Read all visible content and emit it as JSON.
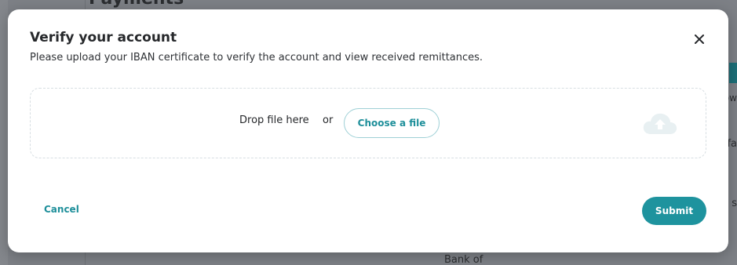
{
  "background": {
    "page_title": "Payments",
    "bank_text": "Bank of",
    "edge_text_1": "ow",
    "edge_text_2": "fa",
    "edge_text_3": "s"
  },
  "modal": {
    "title": "Verify your account",
    "subtitle": "Please upload your IBAN certificate to verify the account and view received remittances.",
    "close_icon": "close-icon",
    "dropzone": {
      "drop_label": "Drop file here",
      "or_label": "or",
      "choose_button": "Choose a file",
      "upload_icon": "cloud-upload-icon"
    },
    "cancel_label": "Cancel",
    "submit_label": "Submit"
  },
  "colors": {
    "accent": "#1e939e",
    "overlay": "#7d8086",
    "dropzone_border": "#d7dee2",
    "upload_icon": "#e8f0f2"
  }
}
